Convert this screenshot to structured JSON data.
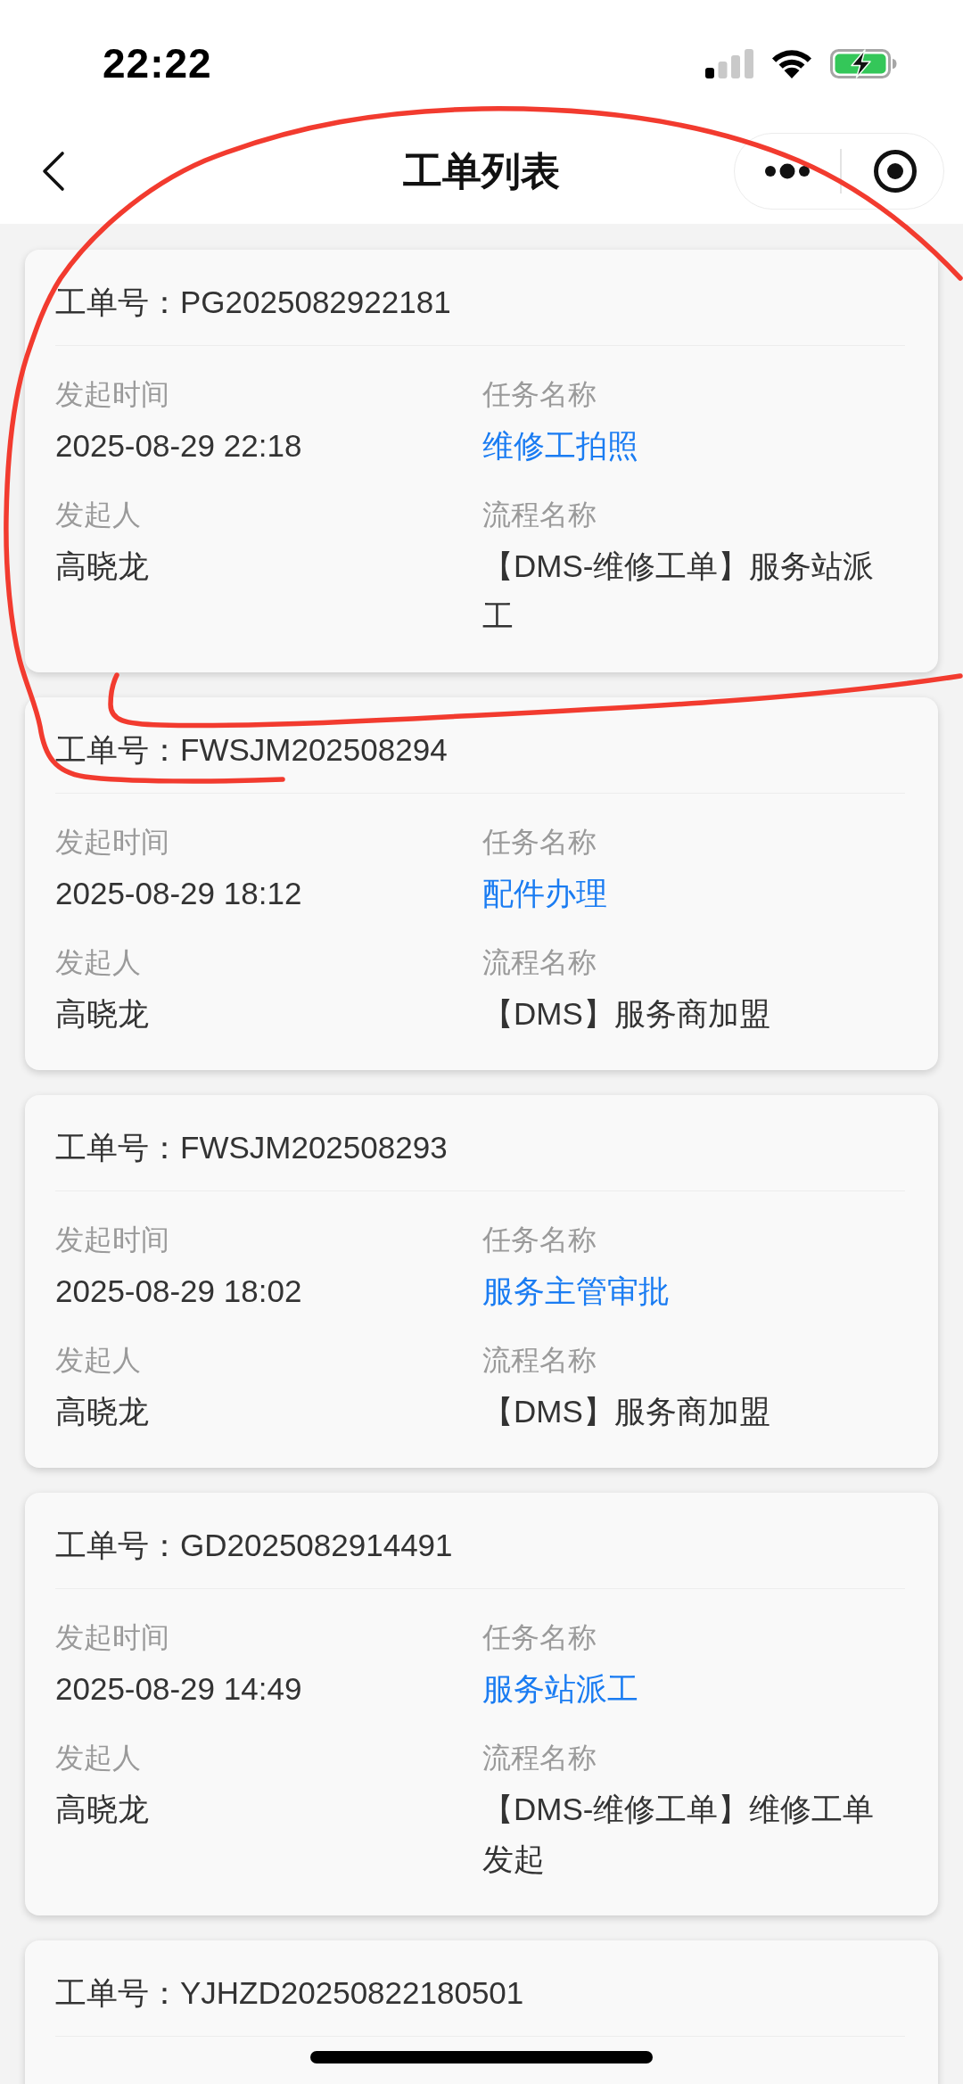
{
  "status_bar": {
    "time": "22:22"
  },
  "nav_bar": {
    "title": "工单列表"
  },
  "orders": [
    {
      "header": "工单号：PG2025082922181",
      "fields": [
        {
          "label": "发起时间",
          "value": "2025-08-29 22:18",
          "kind": "plain"
        },
        {
          "label": "任务名称",
          "value": "维修工拍照",
          "kind": "highlight"
        },
        {
          "label": "发起人",
          "value": "高晓龙",
          "kind": "plain"
        },
        {
          "label": "流程名称",
          "value": "【DMS-维修工单】服务站派工",
          "kind": "plain"
        }
      ]
    },
    {
      "header": "工单号：FWSJM202508294",
      "fields": [
        {
          "label": "发起时间",
          "value": "2025-08-29 18:12",
          "kind": "plain"
        },
        {
          "label": "任务名称",
          "value": "配件办理",
          "kind": "highlight"
        },
        {
          "label": "发起人",
          "value": "高晓龙",
          "kind": "plain"
        },
        {
          "label": "流程名称",
          "value": "【DMS】服务商加盟",
          "kind": "plain"
        }
      ]
    },
    {
      "header": "工单号：FWSJM202508293",
      "fields": [
        {
          "label": "发起时间",
          "value": "2025-08-29 18:02",
          "kind": "plain"
        },
        {
          "label": "任务名称",
          "value": "服务主管审批",
          "kind": "highlight"
        },
        {
          "label": "发起人",
          "value": "高晓龙",
          "kind": "plain"
        },
        {
          "label": "流程名称",
          "value": "【DMS】服务商加盟",
          "kind": "plain"
        }
      ]
    },
    {
      "header": "工单号：GD2025082914491",
      "fields": [
        {
          "label": "发起时间",
          "value": "2025-08-29 14:49",
          "kind": "plain"
        },
        {
          "label": "任务名称",
          "value": "服务站派工",
          "kind": "highlight"
        },
        {
          "label": "发起人",
          "value": "高晓龙",
          "kind": "plain"
        },
        {
          "label": "流程名称",
          "value": "【DMS-维修工单】维修工单发起",
          "kind": "plain"
        }
      ]
    },
    {
      "header": "工单号：YJHZD20250822180501"
    }
  ]
}
